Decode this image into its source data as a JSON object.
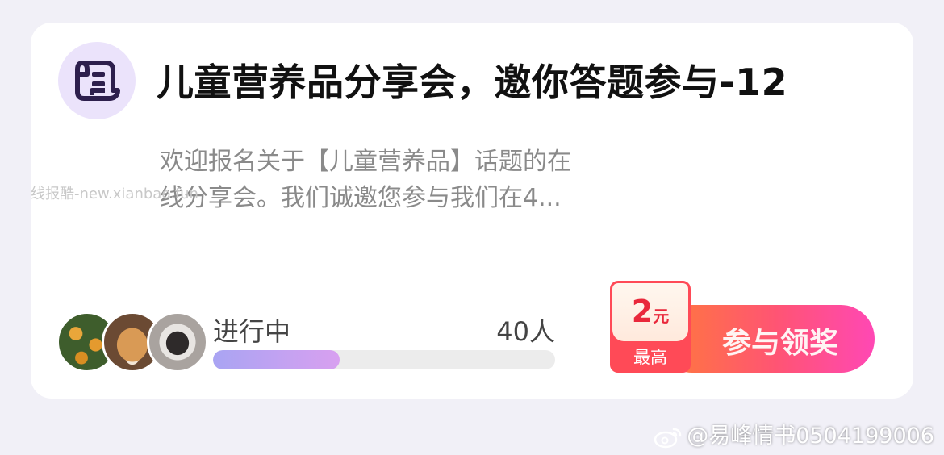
{
  "card": {
    "icon": "scroll-document-icon",
    "title": "儿童营养品分享会，邀你答题参与-12",
    "description_line1": "欢迎报名关于【儿童营养品】话题的在",
    "description_line2": "线分享会。我们诚邀您参与我们在4...",
    "watermark": "线报酷-new.xianbao.fun"
  },
  "participants": {
    "avatars": [
      "oranges-avatar",
      "corgi-dog-avatar",
      "girl-portrait-avatar"
    ],
    "status": "进行中",
    "count": "40人",
    "progress": 0.37
  },
  "cta": {
    "label": "参与领奖",
    "reward_amount": "2",
    "reward_unit": "元",
    "reward_label": "最高"
  },
  "footer": {
    "text": "@易峰情书0504199006"
  },
  "colors": {
    "page_bg": "#f1f0f7",
    "icon_bg": "#ebe3fb",
    "icon_fg": "#2d1f4d",
    "cta_gradient_start": "#ff7a3a",
    "cta_gradient_end": "#ff48b4",
    "reward_red": "#ff4a57",
    "progress_start": "#a9a4f3",
    "progress_end": "#d8a0f0"
  }
}
